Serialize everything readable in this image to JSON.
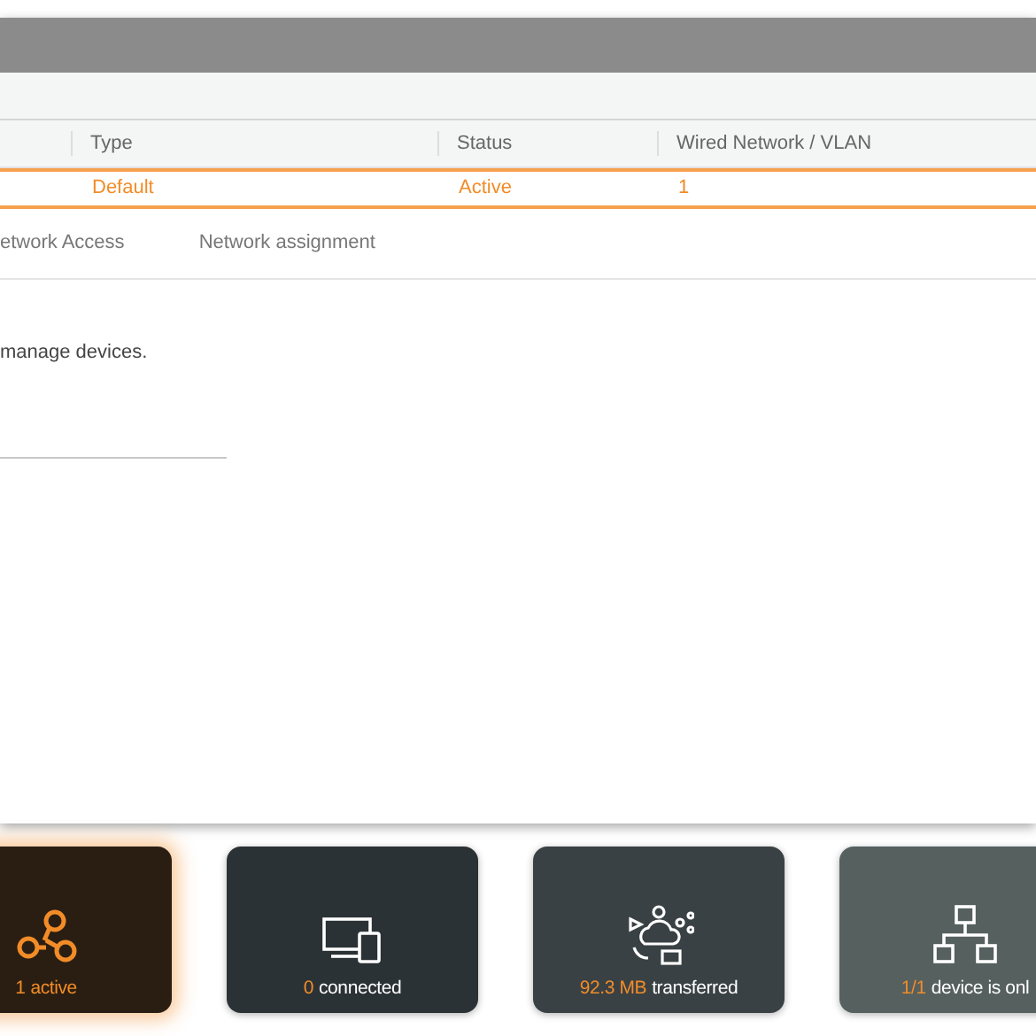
{
  "table": {
    "columns": [
      "Type",
      "Status",
      "Wired Network / VLAN"
    ],
    "rows": [
      {
        "cells": [
          "Default",
          "Active",
          "1"
        ],
        "selected": true
      }
    ]
  },
  "tabs": [
    {
      "label": "etwork Access",
      "selected": false
    },
    {
      "label": "Network assignment",
      "selected": false
    }
  ],
  "description": "manage devices.",
  "cards": [
    {
      "kind": "network",
      "value": "1",
      "label": "active",
      "selected": true
    },
    {
      "kind": "devices",
      "value": "0",
      "label": "connected",
      "selected": false
    },
    {
      "kind": "traffic",
      "value": "92.3 MB",
      "label": "transferred",
      "selected": false
    },
    {
      "kind": "topology",
      "value": "1/1",
      "label": "device is onl",
      "selected": false
    }
  ]
}
